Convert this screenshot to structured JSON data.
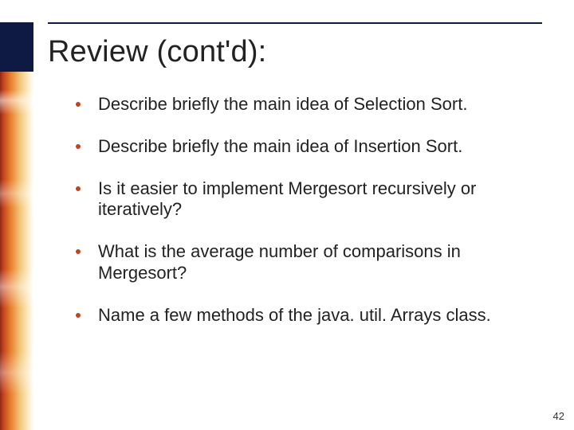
{
  "title": "Review (cont'd):",
  "bullets": [
    "Describe briefly the main idea of Selection Sort.",
    "Describe briefly the main idea of Insertion Sort.",
    "Is it easier to implement Mergesort recursively or iteratively?",
    "What is the average number of comparisons in Mergesort?",
    "Name a few methods of the java. util. Arrays class."
  ],
  "page_number": "42",
  "accent_color": "#c2431f",
  "rule_color": "#0f1b45"
}
